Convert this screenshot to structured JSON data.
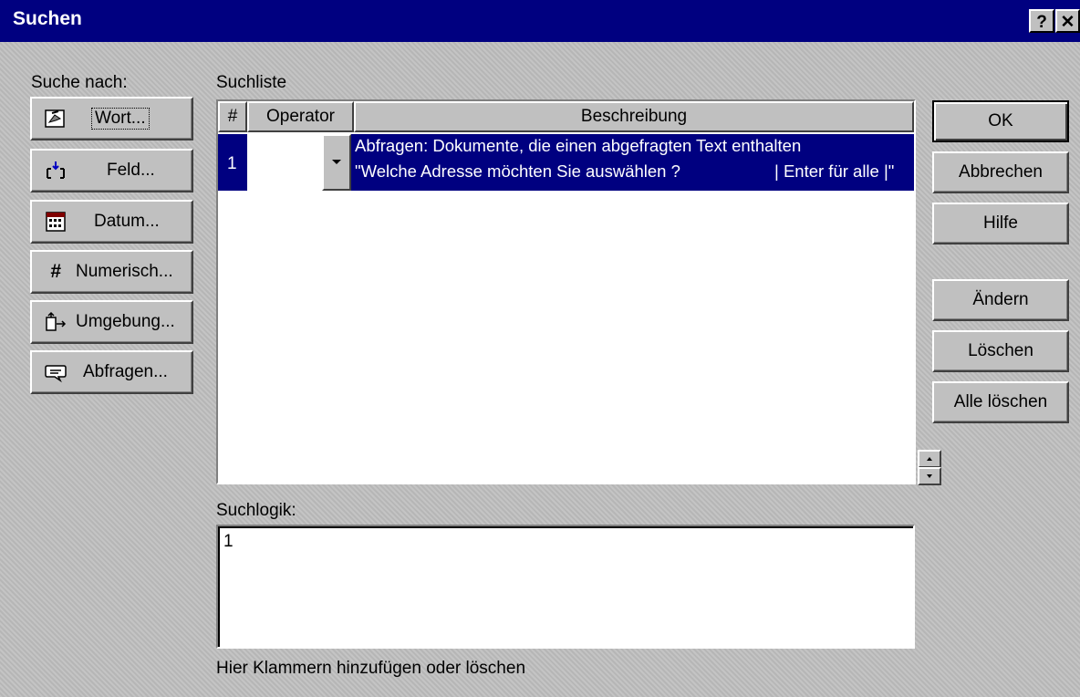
{
  "window": {
    "title": "Suchen",
    "help_button": "?",
    "close_button": "✕"
  },
  "search_for": {
    "label": "Suche nach:",
    "buttons": [
      {
        "label": "Wort...",
        "icon": "word-icon"
      },
      {
        "label": "Feld...",
        "icon": "field-icon"
      },
      {
        "label": "Datum...",
        "icon": "calendar-icon"
      },
      {
        "label": "Numerisch...",
        "icon": "hash-icon"
      },
      {
        "label": "Umgebung...",
        "icon": "proximity-icon"
      },
      {
        "label": "Abfragen...",
        "icon": "speech-bubble-icon"
      }
    ]
  },
  "search_list": {
    "label": "Suchliste",
    "columns": [
      "#",
      "Operator",
      "Beschreibung"
    ],
    "rows": [
      {
        "num": "1",
        "operator": "",
        "description_line1": "Abfragen: Dokumente, die einen abgefragten Text enthalten",
        "description_line2_left": "\"Welche Adresse möchten Sie auswählen ?",
        "description_line2_right": "| Enter für alle |\""
      }
    ]
  },
  "search_logic": {
    "label": "Suchlogik:",
    "value": "1",
    "hint": "Hier Klammern hinzufügen oder löschen"
  },
  "actions": {
    "ok": "OK",
    "cancel": "Abbrechen",
    "help": "Hilfe",
    "edit": "Ändern",
    "delete": "Löschen",
    "delete_all": "Alle löschen"
  },
  "colors": {
    "title_bar": "#000080",
    "selection": "#000080",
    "face": "#c0c0c0"
  }
}
